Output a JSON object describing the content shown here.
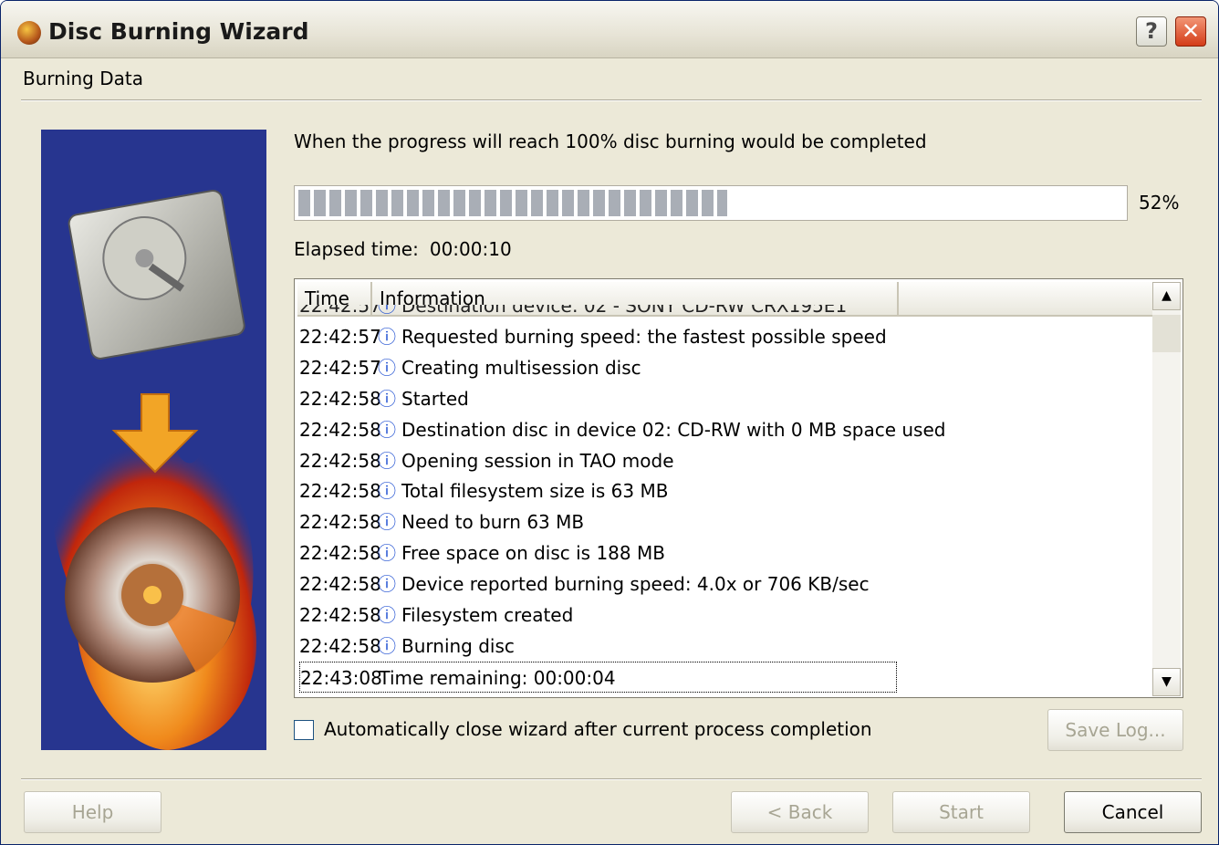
{
  "window": {
    "title": "Disc Burning Wizard",
    "help_glyph": "?",
    "close_glyph": "✕"
  },
  "page": {
    "subtitle": "Burning Data"
  },
  "progress": {
    "message": "When the progress will reach 100% disc burning would be completed",
    "percent_value": 52,
    "percent_label": "52%",
    "elapsed_label": "Elapsed time:",
    "elapsed_value": "00:00:10"
  },
  "log": {
    "columns": [
      "Time",
      "Information"
    ],
    "rows": [
      {
        "time": "22:42:57",
        "info": "Requested burning speed: the fastest possible speed"
      },
      {
        "time": "22:42:57",
        "info": "Creating multisession disc"
      },
      {
        "time": "22:42:58",
        "info": "Started"
      },
      {
        "time": "22:42:58",
        "info": "Destination disc in device 02: CD-RW with 0 MB space used"
      },
      {
        "time": "22:42:58",
        "info": "Opening session in TAO mode"
      },
      {
        "time": "22:42:58",
        "info": "Total filesystem size is 63 MB"
      },
      {
        "time": "22:42:58",
        "info": "Need to burn 63 MB"
      },
      {
        "time": "22:42:58",
        "info": "Free space on disc is 188 MB"
      },
      {
        "time": "22:42:58",
        "info": "Device reported burning speed: 4.0x or 706 KB/sec"
      },
      {
        "time": "22:42:58",
        "info": "Filesystem created"
      },
      {
        "time": "22:42:58",
        "info": "Burning disc"
      }
    ],
    "selected_row": {
      "time": "22:43:08",
      "info": "Time remaining: 00:00:04"
    }
  },
  "options": {
    "auto_close_label": "Automatically close wizard after current process completion",
    "auto_close_checked": false
  },
  "buttons": {
    "save_log": "Save Log...",
    "help": "Help",
    "back": "< Back",
    "start": "Start",
    "cancel": "Cancel"
  },
  "colors": {
    "side_panel": "#27358f",
    "progress_fill": "#a9aeb6",
    "window_bg": "#ece9d8"
  }
}
